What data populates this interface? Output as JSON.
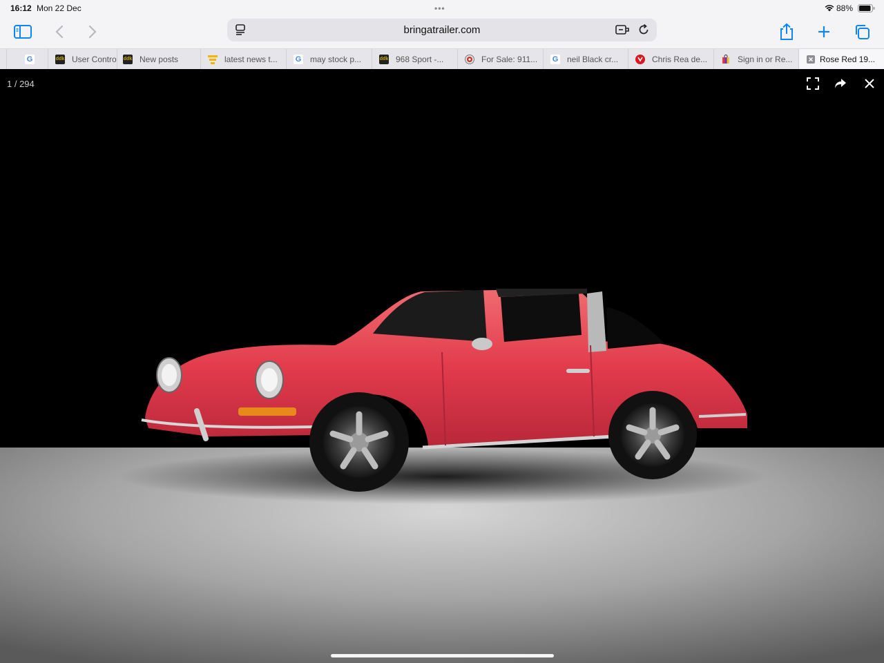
{
  "status": {
    "time": "16:12",
    "date": "Mon 22 Dec",
    "battery": "88%"
  },
  "toolbar": {
    "url": "bringatrailer.com"
  },
  "tabs": [
    {
      "label": "",
      "icon": "google-icon"
    },
    {
      "label": "User Contro",
      "icon": "ddk-icon"
    },
    {
      "label": "New posts",
      "icon": "ddk-icon"
    },
    {
      "label": "latest news t...",
      "icon": "news-icon"
    },
    {
      "label": "may stock p...",
      "icon": "google-icon"
    },
    {
      "label": "968 Sport -...",
      "icon": "ddk-icon"
    },
    {
      "label": "For Sale: 911...",
      "icon": "target-icon"
    },
    {
      "label": "neil Black cr...",
      "icon": "google-icon"
    },
    {
      "label": "Chris Rea de...",
      "icon": "red-circle-icon"
    },
    {
      "label": "Sign in or Re...",
      "icon": "bag-icon"
    },
    {
      "label": "Rose Red 19...",
      "icon": "close-icon"
    }
  ],
  "viewer": {
    "counter": "1 / 294"
  },
  "colors": {
    "chrome": "#f4f4f6",
    "tab_strip": "#e6e6ea",
    "car_body": "#e0394a",
    "accent": "#0a84ff"
  }
}
